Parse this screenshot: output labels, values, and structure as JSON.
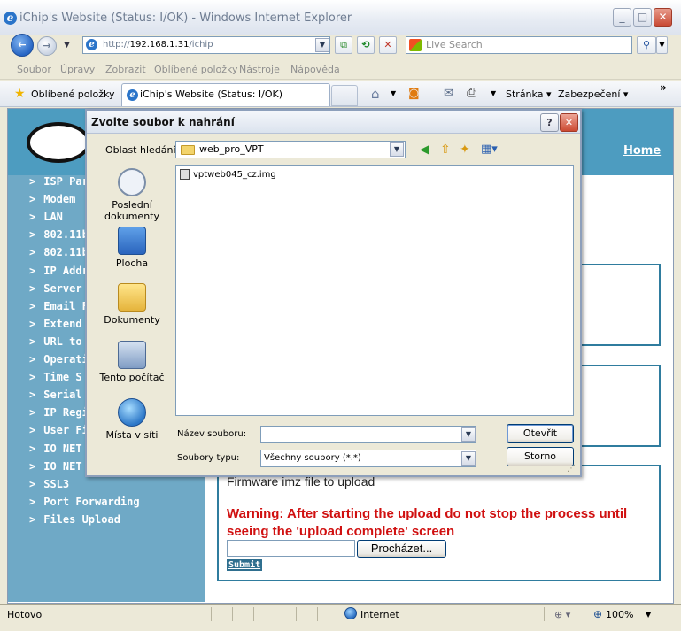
{
  "window": {
    "title": "iChip's Website (Status: I/OK) - Windows Internet Explorer",
    "min": "_",
    "max": "□",
    "close": "✕"
  },
  "address": {
    "scheme": "http://",
    "host": "192.168.1.31",
    "path": "/ichip"
  },
  "search": {
    "placeholder": "Live Search"
  },
  "menu": [
    "Soubor",
    "Úpravy",
    "Zobrazit",
    "Oblíbené položky",
    "Nástroje",
    "Nápověda"
  ],
  "favorites": {
    "label": "Oblíbené položky",
    "tab_title": "iChip's Website (Status: I/OK)",
    "page_menu": "Stránka",
    "security_menu": "Zabezpečení",
    "more": "»"
  },
  "page": {
    "home": "Home",
    "nav": [
      "ISP Par",
      "Modem",
      "LAN",
      "802.11b",
      "802.11b",
      "IP Addr",
      "Server",
      "Email F",
      "Extend",
      "URL to",
      "Operati",
      "Time S",
      "Serial I",
      "IP Regi",
      "User Fi",
      "IO NET",
      "IO NET",
      "SSL3",
      "Port Forwarding",
      "Files Upload"
    ],
    "nav_bullet": ">",
    "upload_title": "Firmware imz file to upload",
    "upload_warning": "Warning: After starting the upload do not stop the process until seeing the 'upload complete' screen",
    "browse": "Procházet...",
    "submit": "Submit"
  },
  "status": {
    "text": "Hotovo",
    "zone": "Internet",
    "zoom": "100%"
  },
  "dialog": {
    "title": "Zvolte soubor k nahrání",
    "help": "?",
    "close": "✕",
    "lookin_label": "Oblast hledání:",
    "lookin_value": "web_pro_VPT",
    "places": [
      {
        "label": "Poslední dokumenty",
        "icon": "recent-documents-icon"
      },
      {
        "label": "Plocha",
        "icon": "desktop-icon"
      },
      {
        "label": "Dokumenty",
        "icon": "documents-icon"
      },
      {
        "label": "Tento počítač",
        "icon": "my-computer-icon"
      },
      {
        "label": "Místa v síti",
        "icon": "network-places-icon"
      }
    ],
    "files": [
      "vptweb045_cz.img"
    ],
    "filename_label": "Název souboru:",
    "filename_value": "",
    "filetype_label": "Soubory typu:",
    "filetype_value": "Všechny soubory (*.*)",
    "open": "Otevřít",
    "cancel": "Storno"
  },
  "colors": {
    "header": "#4d9cc0",
    "nav_bg": "#6fa9c6",
    "warning": "#d01010",
    "box_border": "#2f7c9e"
  }
}
